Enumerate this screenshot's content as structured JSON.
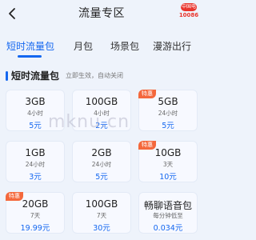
{
  "header": {
    "title": "流量专区",
    "logo_badge": "中国电信",
    "logo_number": "10086"
  },
  "tabs": [
    {
      "label": "短时流量包",
      "active": true
    },
    {
      "label": "月包",
      "active": false
    },
    {
      "label": "场景包",
      "active": false
    },
    {
      "label": "漫游出行",
      "active": false
    }
  ],
  "section": {
    "title": "短时流量包",
    "subtitle": "立即生效，自动关闭"
  },
  "packages": [
    {
      "amount": "3GB",
      "duration": "4小时",
      "price": "5元",
      "badge": ""
    },
    {
      "amount": "100GB",
      "duration": "4小时",
      "price": "2元",
      "badge": ""
    },
    {
      "amount": "5GB",
      "duration": "24小时",
      "price": "5元",
      "badge": "特惠"
    },
    {
      "amount": "1GB",
      "duration": "24小时",
      "price": "3元",
      "badge": ""
    },
    {
      "amount": "2GB",
      "duration": "24小时",
      "price": "5元",
      "badge": ""
    },
    {
      "amount": "10GB",
      "duration": "3天",
      "price": "10元",
      "badge": "特惠"
    },
    {
      "amount": "20GB",
      "duration": "7天",
      "price": "19.99元",
      "badge": "特惠"
    },
    {
      "amount": "100GB",
      "duration": "7天",
      "price": "30元",
      "badge": ""
    },
    {
      "amount": "畅聊语音包",
      "duration": "每分钟低至",
      "price": "0.034元",
      "badge": ""
    }
  ],
  "watermark": "mknu.cn",
  "colors": {
    "accent": "#1467f0",
    "badge": "#f4683c",
    "brand": "#e9342c"
  }
}
